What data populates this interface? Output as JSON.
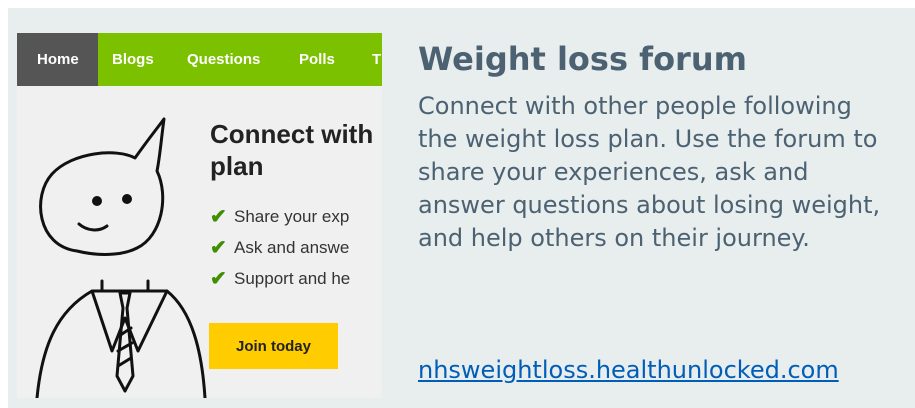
{
  "promo": {
    "title": "Weight loss forum",
    "description": "Connect with other people following the weight loss plan. Use the forum to share your experiences, ask and answer questions about losing weight, and help others on their journey.",
    "link_text": "nhsweightloss.healthunlocked.com"
  },
  "screenshot": {
    "nav": [
      {
        "label": "Home",
        "active": true
      },
      {
        "label": "Blogs"
      },
      {
        "label": "Questions"
      },
      {
        "label": "Polls"
      },
      {
        "label": "T"
      }
    ],
    "headline": "Connect with\nplan",
    "bullets": [
      "Share your exp",
      "Ask and answe",
      "Support and he"
    ],
    "join_label": "Join today"
  },
  "colors": {
    "nav_green": "#7cc100",
    "nav_active": "#555555",
    "join_yellow": "#ffcc00",
    "text_slate": "#4c6272",
    "link_blue": "#005eb8",
    "card_bg": "#e8edee"
  }
}
